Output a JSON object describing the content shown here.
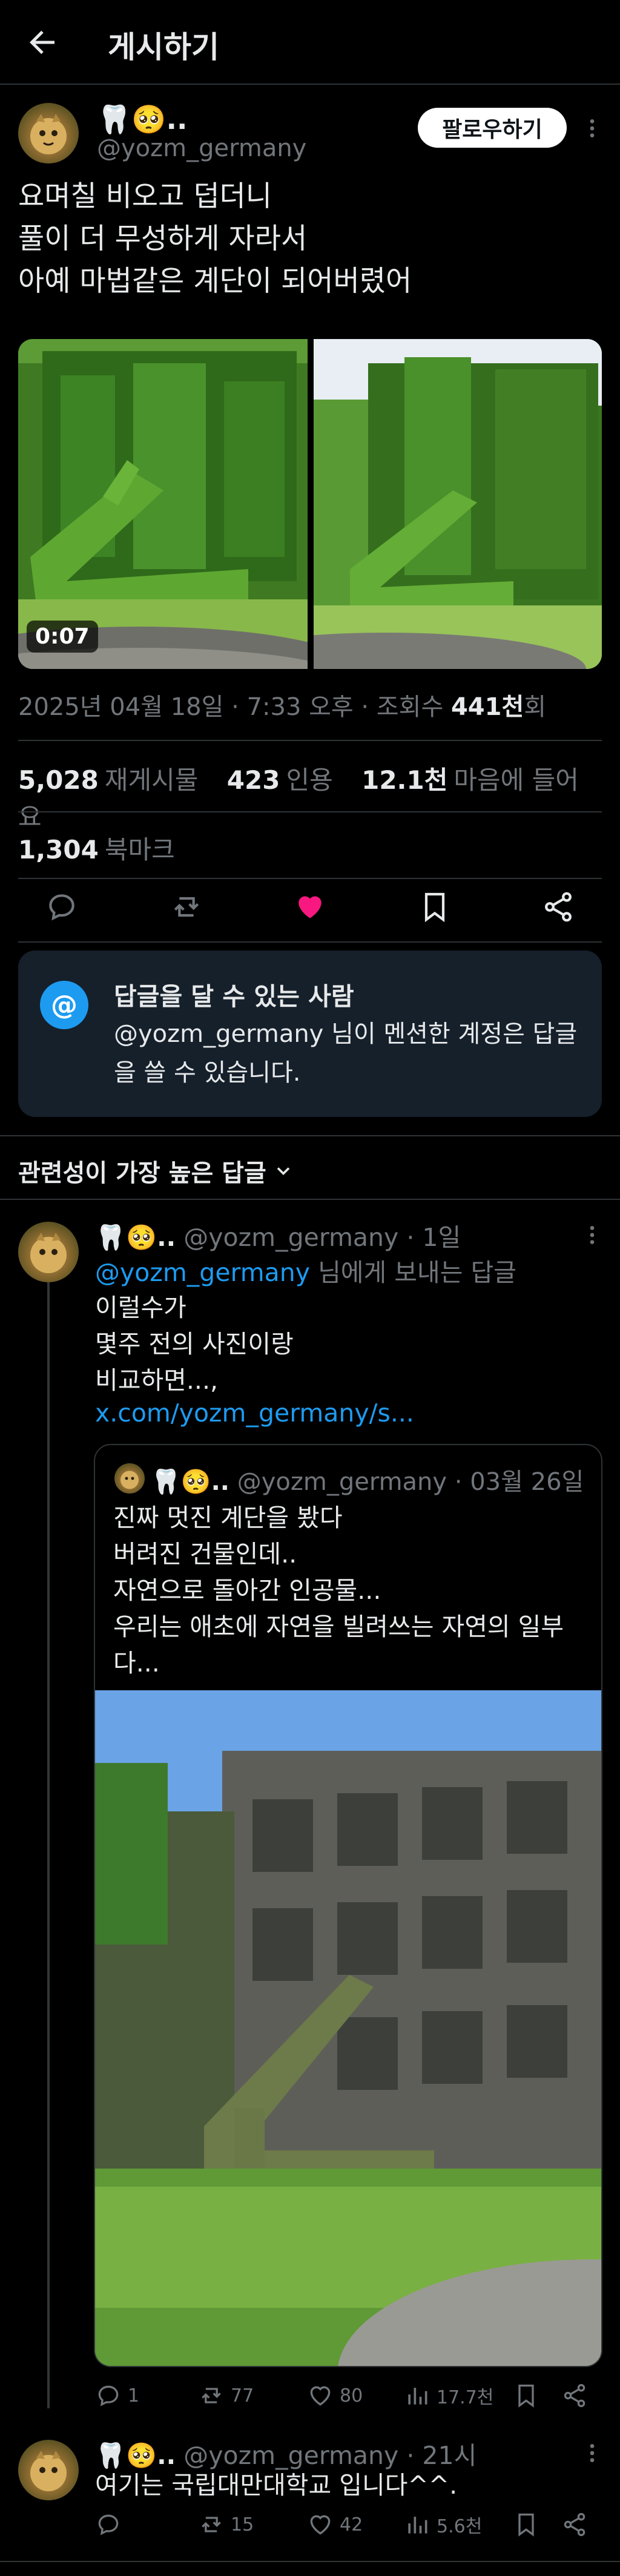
{
  "header": {
    "title": "게시하기"
  },
  "post": {
    "display_name": "🦷🥺..",
    "handle": "@yozm_germany",
    "follow_label": "팔로우하기",
    "text": "요며칠 비오고 덥더니\n풀이 더 무성하게 자라서\n아예 마법같은 계단이 되어버렸어",
    "video_duration": "0:07",
    "date": "2025년 04월 18일 · 7:33 오후 · 조회수 ",
    "views": "441천",
    "views_suffix": "회",
    "reposts_count": "5,028",
    "reposts_label": "재게시물",
    "quotes_count": "423",
    "quotes_label": "인용",
    "likes_count": "12.1천",
    "likes_label": "마음에 들어요",
    "bookmarks_count": "1,304",
    "bookmarks_label": "북마크",
    "liked": true,
    "accent_color": "#1d9bf0",
    "like_color": "#f91880"
  },
  "reply_restriction": {
    "icon": "at-icon",
    "title": "답글을 달 수 있는 사람",
    "body": "@yozm_germany 님이 멘션한 계정은 답글을 쓸 수 있습니다."
  },
  "sort_label": "관련성이 가장 높은 답글",
  "replies": [
    {
      "display_name": "🦷🥺..",
      "handle": "@yozm_germany",
      "time": "· 1일",
      "reply_to_handle": "@yozm_germany",
      "reply_to_suffix": "님에게 보내는 답글",
      "text": "이럴수가\n몇주 전의 사진이랑\n비교하면...,",
      "link": "x.com/yozm_germany/s...",
      "quote": {
        "display_name": "🦷🥺..",
        "handle": "@yozm_germany",
        "time": "· 03월 26일",
        "text": "진짜 멋진 계단을 봤다\n버려진 건물인데..\n자연으로 돌아간 인공물...\n우리는 애초에 자연을 빌려쓰는 자연의 일부다..."
      },
      "replies": "1",
      "reposts": "77",
      "likes": "80",
      "views": "17.7천"
    },
    {
      "display_name": "🦷🥺..",
      "handle": "@yozm_germany",
      "time": "· 21시",
      "text": "여기는 국립대만대학교 입니다^^.",
      "replies": "",
      "reposts": "15",
      "likes": "42",
      "views": "5.6천"
    }
  ]
}
